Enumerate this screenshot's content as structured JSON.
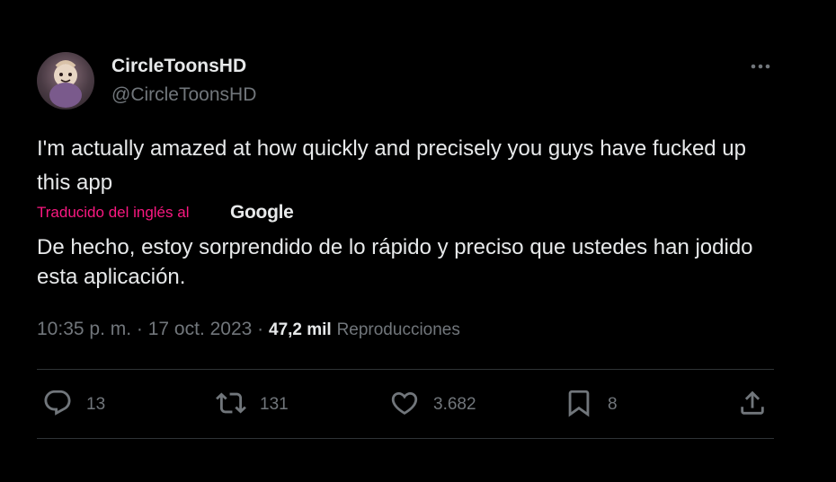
{
  "author": {
    "display_name": "CircleToonsHD",
    "handle": "@CircleToonsHD"
  },
  "tweet": {
    "text": "I'm actually amazed at how quickly and precisely you guys have fucked up this app",
    "translated_from_label": "Traducido del inglés al",
    "translator_brand": "Google",
    "translation": "De hecho, estoy sorprendido de lo rápido y preciso que ustedes han jodido esta aplicación.",
    "time": "10:35 p. m.",
    "separator": " · ",
    "date": "17 oct. 2023",
    "views_count": "47,2 mil",
    "views_label": "Reproducciones"
  },
  "actions": {
    "replies": "13",
    "reposts": "131",
    "likes": "3.682",
    "bookmarks": "8"
  },
  "icons": [
    "more-icon",
    "reply-icon",
    "repost-icon",
    "like-icon",
    "bookmark-icon",
    "share-icon"
  ],
  "colors": {
    "background": "#000000",
    "text": "#e7e9ea",
    "secondary": "#71767b",
    "translation_link": "#f91880",
    "divider": "#2f3336"
  }
}
